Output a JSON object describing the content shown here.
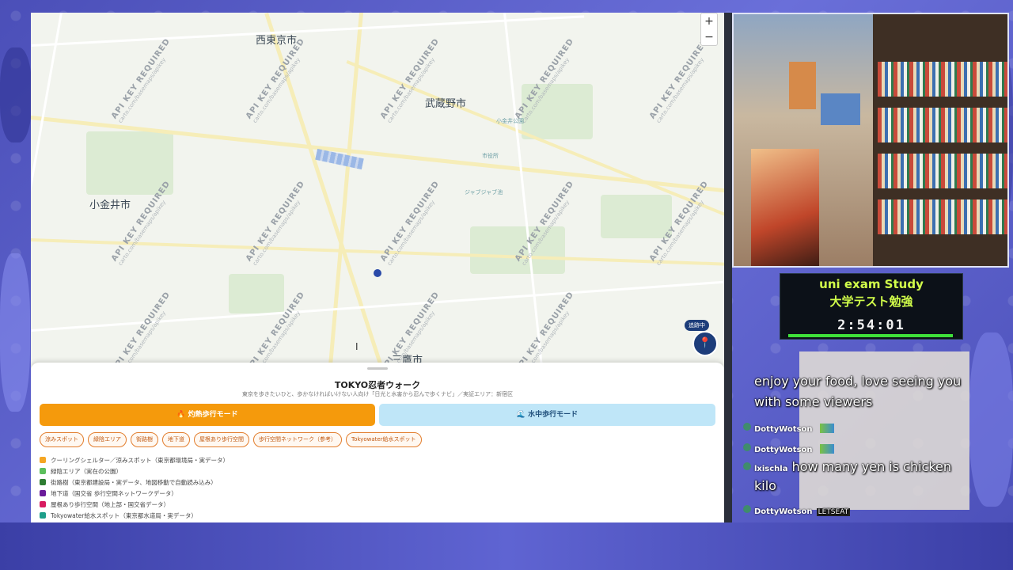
{
  "map": {
    "cities": {
      "nishitokyo": "西東京市",
      "musashino": "武蔵野市",
      "koganei": "小金井市",
      "mitaka": "三鷹市"
    },
    "watermark": {
      "label": "API KEY REQUIRED",
      "sub": "carto.com/basemaps/apikey"
    },
    "zoom": {
      "in": "+",
      "out": "−"
    },
    "follow_badge": "追跡中",
    "pois": [
      "ジャブジャブ池",
      "小金井公園",
      "市役所"
    ]
  },
  "app": {
    "title": "TOKYO忍者ウォーク",
    "subtitle": "東京を歩きたいひと、歩かなければいけない人向け「日光と水害から忍んで歩くナビ」／実証エリア：新宿区",
    "modes": {
      "heat": "🔥 灼熱歩行モード",
      "water": "🌊 水中歩行モード"
    },
    "chips": [
      "涼みスポット",
      "緑陰エリア",
      "街路樹",
      "地下道",
      "屋根あり歩行空間",
      "歩行空間ネットワーク（参考）",
      "Tokyowater給水スポット"
    ],
    "legend": [
      {
        "label": "クーリングシェルター／涼みスポット（東京都環境局・実データ）",
        "color": "#f5a623"
      },
      {
        "label": "緑陰エリア（実在の公園）",
        "color": "#5cbf5c"
      },
      {
        "label": "街路樹（東京都建設局・実データ、地図移動で自動読み込み）",
        "color": "#2e7d32"
      },
      {
        "label": "地下道（国交省 歩行空間ネットワークデータ）",
        "color": "#6a1b9a"
      },
      {
        "label": "屋根あり歩行空間（地上部・国交省データ）",
        "color": "#d81b60"
      },
      {
        "label": "Tokyowater給水スポット（東京都水道局・実データ）",
        "color": "#1e9e8a"
      }
    ]
  },
  "stream": {
    "timer_title_en": "uni exam Study",
    "timer_title_ja": "大学テスト勉強",
    "timer_value": "2:54:01",
    "timer_progress": 1.0,
    "chat": [
      {
        "user": "",
        "text": "enjoy your food, love seeing you"
      },
      {
        "user": "",
        "text": "with some viewers"
      },
      {
        "user": "DottyWotson",
        "text": ""
      },
      {
        "user": "DottyWotson",
        "text": ""
      },
      {
        "user": "lxischla",
        "text": "how many yen is chicken"
      },
      {
        "user": "",
        "text": "kilo"
      },
      {
        "user": "DottyWotson",
        "text": "LETSEAT"
      }
    ]
  }
}
